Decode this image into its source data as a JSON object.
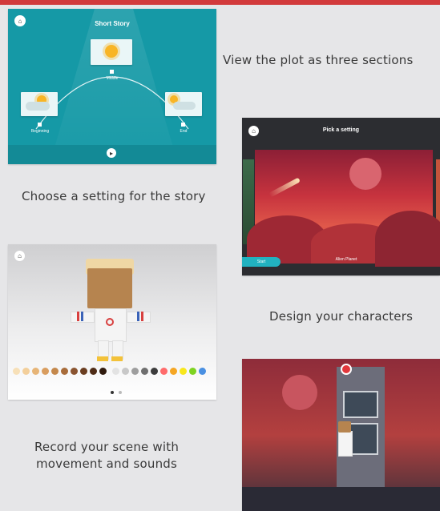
{
  "captions": {
    "plot": "View the plot as three sections",
    "setting": "Choose a setting for the story",
    "characters": "Design your characters",
    "record": "Record your scene with movement and sounds"
  },
  "screen_plot": {
    "title": "Short Story",
    "sections": [
      "Beginning",
      "Middle",
      "End"
    ],
    "accent": "#1599a6"
  },
  "screen_setting": {
    "title": "Pick a setting",
    "button": "Start",
    "scene_name": "Alien Planet"
  },
  "screen_character": {
    "palette": [
      "#f7e0b8",
      "#f3cf9b",
      "#e7b577",
      "#d99d5f",
      "#c4884c",
      "#a86c3a",
      "#8a5430",
      "#6a3d20",
      "#4e2b16",
      "#2f1a0d",
      "#e3e3e3",
      "#c8c8c8",
      "#9e9e9e",
      "#6f6f6f",
      "#3c3c3c",
      "#ff6b6b",
      "#f5a623",
      "#f8e71c",
      "#7ed321",
      "#4a90e2"
    ]
  },
  "screen_record": {
    "accent": "#e2383c"
  },
  "colors": {
    "top_bar": "#d23a3c"
  }
}
